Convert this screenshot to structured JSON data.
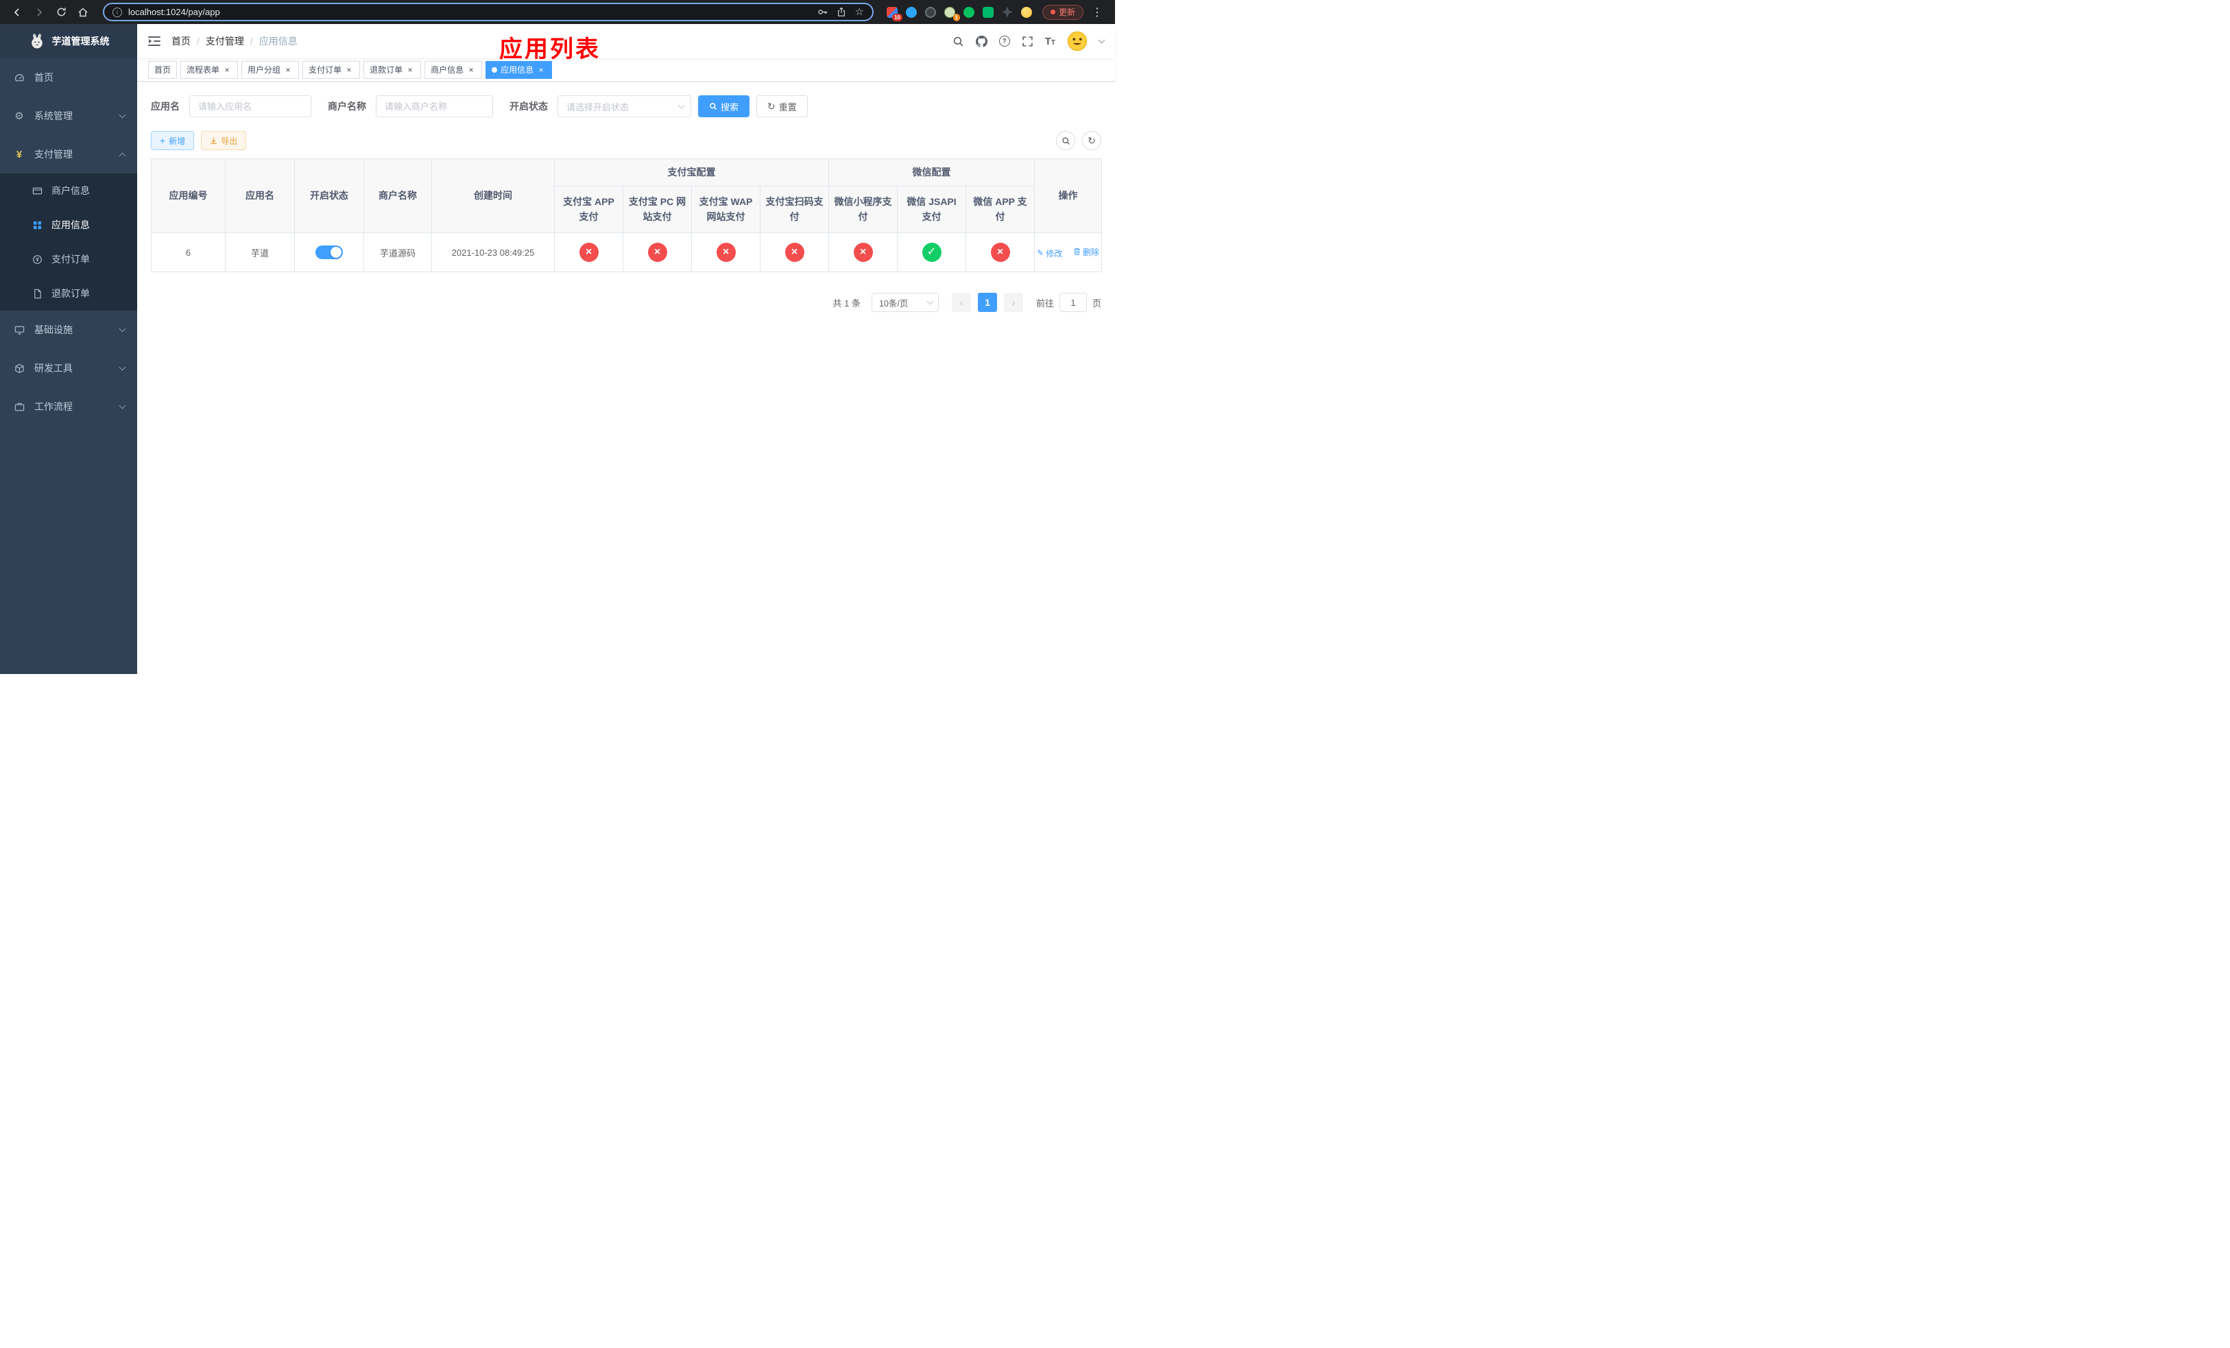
{
  "browser": {
    "url": "localhost:1024/pay/app",
    "update_label": "更新",
    "ext_badge_adblock": "10",
    "ext_badge_avatar": "1"
  },
  "sidebar": {
    "logo_title": "芋道管理系统",
    "items": [
      {
        "label": "首页",
        "icon": "dashboard-icon"
      },
      {
        "label": "系统管理",
        "icon": "gear-icon"
      },
      {
        "label": "支付管理",
        "icon": "yen-icon",
        "expanded": true
      },
      {
        "label": "基础设施",
        "icon": "server-icon"
      },
      {
        "label": "研发工具",
        "icon": "toolbox-icon"
      },
      {
        "label": "工作流程",
        "icon": "briefcase-icon"
      }
    ],
    "payment_children": [
      {
        "label": "商户信息",
        "icon": "bank-card-icon"
      },
      {
        "label": "应用信息",
        "icon": "grid-icon",
        "active": true
      },
      {
        "label": "支付订单",
        "icon": "pay-order-icon"
      },
      {
        "label": "退款订单",
        "icon": "refund-doc-icon"
      }
    ]
  },
  "header": {
    "breadcrumb": [
      "首页",
      "支付管理",
      "应用信息"
    ],
    "annotation": "应用列表"
  },
  "tabs": [
    {
      "label": "首页",
      "closable": false,
      "active": false
    },
    {
      "label": "流程表单",
      "closable": true,
      "active": false
    },
    {
      "label": "用户分组",
      "closable": true,
      "active": false
    },
    {
      "label": "支付订单",
      "closable": true,
      "active": false
    },
    {
      "label": "退款订单",
      "closable": true,
      "active": false
    },
    {
      "label": "商户信息",
      "closable": true,
      "active": false
    },
    {
      "label": "应用信息",
      "closable": true,
      "active": true
    }
  ],
  "filters": {
    "app_name_label": "应用名",
    "app_name_placeholder": "请输入应用名",
    "merchant_label": "商户名称",
    "merchant_placeholder": "请输入商户名称",
    "status_label": "开启状态",
    "status_placeholder": "请选择开启状态",
    "search_label": "搜索",
    "reset_label": "重置"
  },
  "toolbar": {
    "add_label": "新增",
    "export_label": "导出"
  },
  "table": {
    "headers_simple": [
      "应用编号",
      "应用名",
      "开启状态",
      "商户名称",
      "创建时间"
    ],
    "group_alipay": "支付宝配置",
    "group_wechat": "微信配置",
    "headers_alipay": [
      "支付宝 APP 支付",
      "支付宝 PC 网站支付",
      "支付宝 WAP 网站支付",
      "支付宝扫码支付"
    ],
    "headers_wechat": [
      "微信小程序支付",
      "微信 JSAPI 支付",
      "微信 APP 支付"
    ],
    "header_actions": "操作",
    "row": {
      "id": "6",
      "name": "芋道",
      "status_on": true,
      "merchant": "芋道源码",
      "created_at": "2021-10-23 08:49:25",
      "alipay_configs": [
        "no",
        "no",
        "no",
        "no"
      ],
      "wechat_configs": [
        "no",
        "yes",
        "no"
      ],
      "edit_label": "修改",
      "delete_label": "删除"
    }
  },
  "pagination": {
    "total_text": "共 1 条",
    "page_size_text": "10条/页",
    "active_page": "1",
    "goto_label": "前往",
    "goto_value": "1",
    "goto_suffix": "页"
  },
  "icons": [
    "back-icon",
    "forward-icon",
    "reload-icon",
    "home-icon",
    "site-info-icon",
    "password-key-icon",
    "share-icon",
    "bookmark-star-icon",
    "browser-menu-icon",
    "search-icon",
    "github-icon",
    "help-icon",
    "fullscreen-icon",
    "font-size-icon",
    "chevron-down-icon",
    "hamburger-icon",
    "plus-icon",
    "download-icon",
    "refresh-icon",
    "edit-icon",
    "delete-icon",
    "close-icon"
  ],
  "colors": {
    "primary": "#409eff",
    "success": "#13ce66",
    "danger": "#f34d4d",
    "warning": "#e6a23c",
    "annotation": "#ff0000",
    "sidebar_bg": "#304156",
    "submenu_bg": "#1f2d3d"
  }
}
